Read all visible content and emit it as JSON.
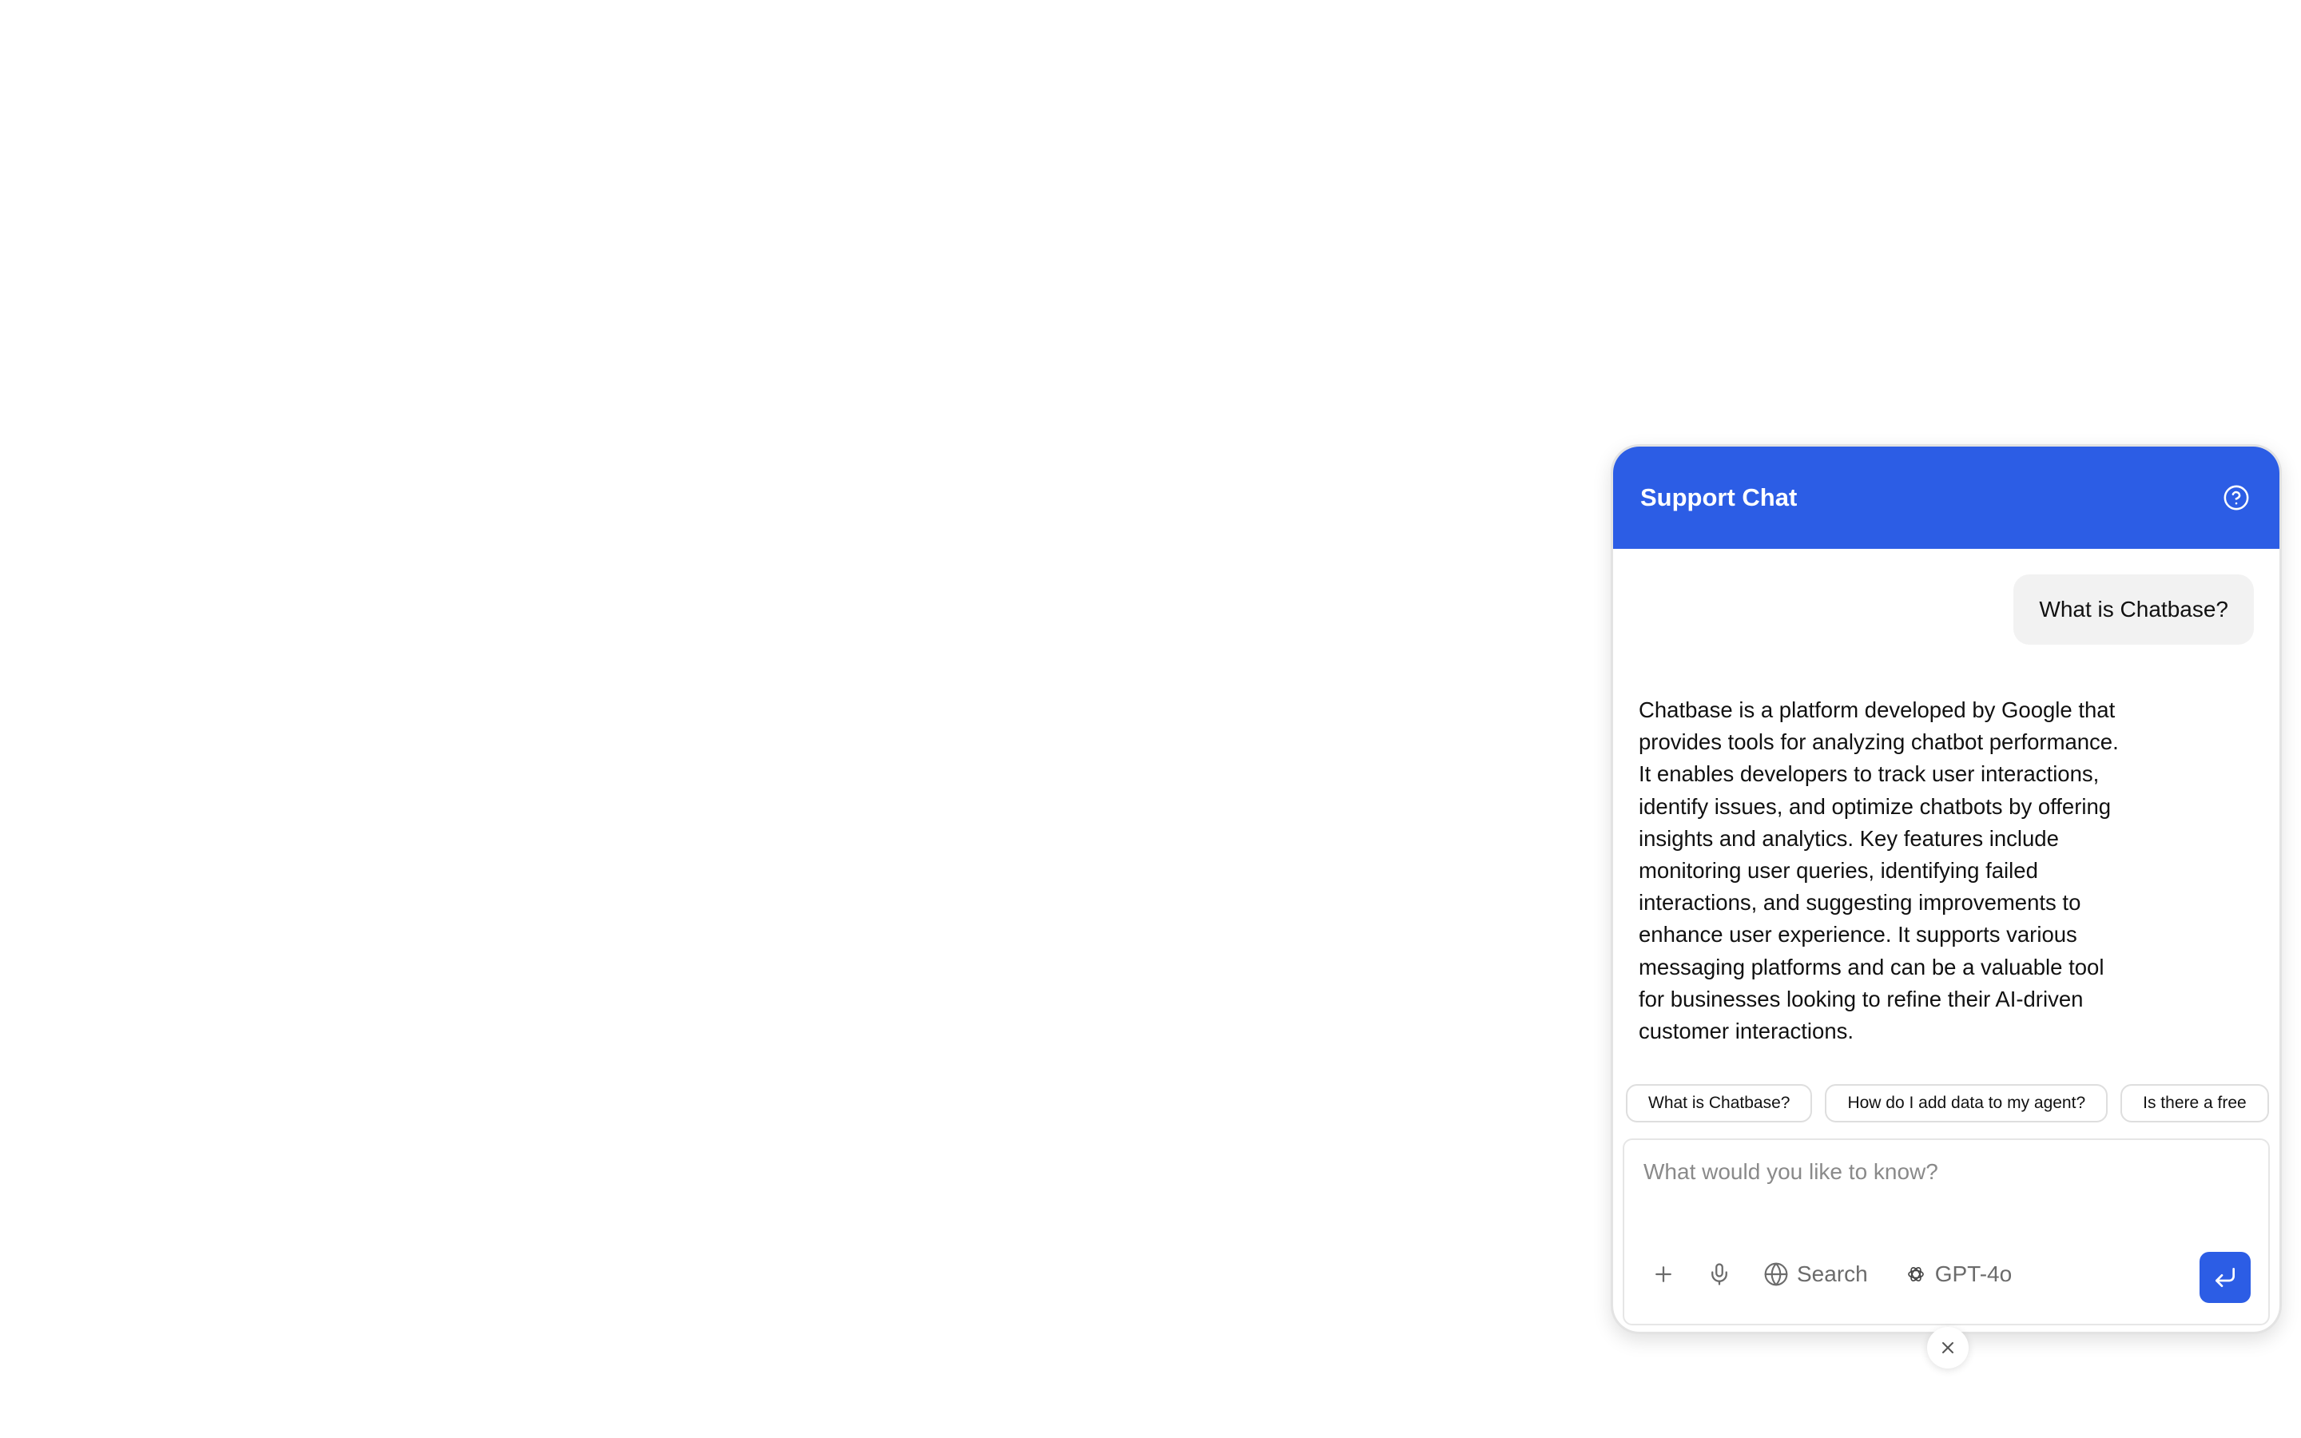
{
  "header": {
    "title": "Support Chat",
    "help_icon": "help-circle-icon"
  },
  "messages": {
    "user": "What is Chatbase?",
    "bot": "Chatbase is a platform developed by Google that provides tools for analyzing chatbot performance. It enables developers to track user interactions, identify issues, and optimize chatbots by offering insights and analytics. Key features include monitoring user queries, identifying failed interactions, and suggesting improvements to enhance user experience. It supports various messaging platforms and can be a valuable tool for businesses looking to refine their AI-driven customer interactions."
  },
  "suggestions": [
    "What is Chatbase?",
    "How do I add data to my agent?",
    "Is there a free"
  ],
  "composer": {
    "placeholder": "What would you like to know?",
    "search_label": "Search",
    "model_label": "GPT-4o",
    "icons": [
      "plus-icon",
      "microphone-icon",
      "globe-icon",
      "openai-icon",
      "enter-icon"
    ]
  },
  "colors": {
    "accent": "#2c5de5",
    "user_bubble": "#f2f2f2"
  },
  "close_icon": "close-icon"
}
